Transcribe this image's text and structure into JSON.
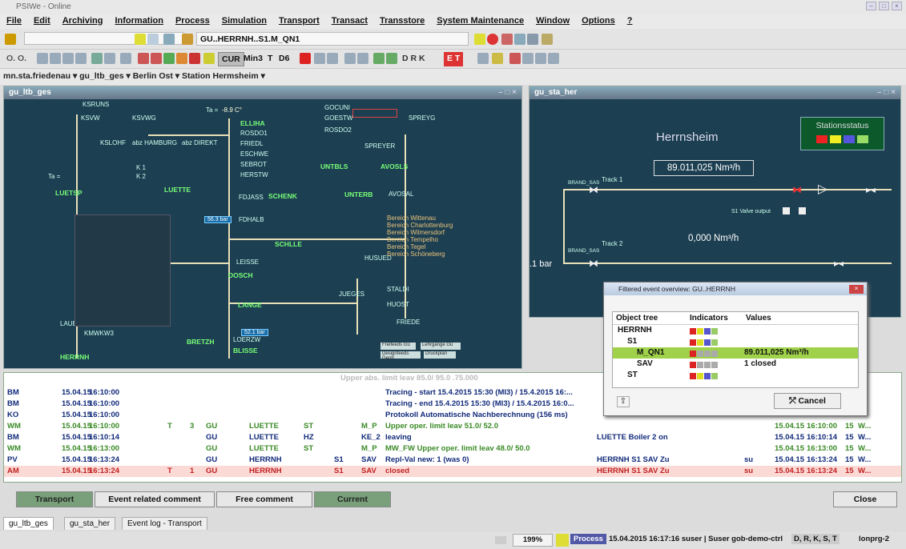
{
  "app": {
    "title": "PSIWe - Online"
  },
  "menu": [
    "File",
    "Edit",
    "Archiving",
    "Information",
    "Process",
    "Simulation",
    "Transport",
    "Transact",
    "Transstore",
    "System Maintenance",
    "Window",
    "Options",
    "?"
  ],
  "toolbar": {
    "object_path": "GU..HERRNH..S1.M_QN1",
    "left_group": "O. O.",
    "cur": "CUR",
    "min3": "Min3",
    "t": "T",
    "d6": "D6",
    "drk": "D R K",
    "gates": "E T"
  },
  "breadcrumbs": [
    "mn.sta.friedenau",
    "gu_ltb_ges",
    "Berlin Ost",
    "Station Hermsheim"
  ],
  "windows": {
    "main": {
      "title": "gu_ltb_ges"
    },
    "station": {
      "title": "gu_sta_her",
      "name": "Herrnsheim",
      "status_label": "Stationsstatus",
      "flow1": "89.011,025 Nm³/h",
      "flow2": "0,000 Nm³/h",
      "track1": "Track 1",
      "track2": "Track 2",
      "brand_sas": "BRAND_SAS",
      "valve_output": "S1 Valve output",
      "pressure": ".1 bar",
      "status_colors": [
        "#e22",
        "#ee2",
        "#55d",
        "#9d6"
      ]
    }
  },
  "schematic": {
    "nodes": [
      "KSRUNS",
      "KSVW",
      "KSVWG",
      "KSLOHF",
      "abz HAMBURG",
      "abz DIREKT",
      "ELLIHA",
      "ROSDO1",
      "FRIEDL",
      "ESCHWE",
      "SEBROT",
      "HERSTW",
      "GOCUNI",
      "GOESTW",
      "ROSDO2",
      "SPREYG",
      "SPREYER",
      "UNTBLS",
      "AVOSLS",
      "SCHENK",
      "UNTERB",
      "AVOSAL",
      "FDJASS",
      "FDHALB",
      "SCHLLE",
      "LEISSE",
      "DOSCH",
      "STALDI",
      "JUEGES",
      "HUOST",
      "FRIEDE",
      "LANGE",
      "LAUBEN",
      "KMWKW3",
      "BRETZH",
      "LOERZW",
      "BLISSE",
      "HERRNH",
      "LUETTE",
      "LUETSP",
      "HUSUED"
    ],
    "temp": "Ta =",
    "temp_val": "-8.9 C°",
    "k1": "K 1",
    "k2": "K 2",
    "legend": [
      "Bereich Wittenau",
      "Bereich Charlottenburg",
      "Bereich Wilmersdorf",
      "Bereich Tempelho",
      "Bereich Tegel",
      "Bereich Schöneberg"
    ],
    "buttons": [
      "Freifeeds Gü",
      "Lehrgänge Gü",
      "Designfeeds Genb",
      "Druckplan"
    ]
  },
  "popup": {
    "title": "Filtered event overview: GU..HERRNH",
    "cols": [
      "Object tree",
      "Indicators",
      "Values"
    ],
    "rows": [
      {
        "name": "HERRNH",
        "value": ""
      },
      {
        "name": "S1",
        "value": ""
      },
      {
        "name": "M_QN1",
        "value": "89.011,025 Nm³/h"
      },
      {
        "name": "SAV",
        "value": "1 closed"
      },
      {
        "name": "ST",
        "value": ""
      }
    ],
    "cancel": "Cancel"
  },
  "log": {
    "top_hidden": "Upper abs. limit leav 85.0/ 95.0 .75.000",
    "rows": [
      {
        "type": "BM",
        "date": "15.04.15",
        "time": "16:10:00",
        "a": "",
        "b": "",
        "c": "",
        "d": "",
        "e": "",
        "f": "",
        "g": "",
        "text": "Tracing - start 15.4.2015 15:30 (MI3) / 15.4.2015 16:...",
        "obj": "",
        "user": "",
        "d2": "",
        "t2": "",
        "n": "",
        "w": ""
      },
      {
        "type": "BM",
        "date": "15.04.15",
        "time": "16:10:00",
        "a": "",
        "b": "",
        "c": "",
        "d": "",
        "e": "",
        "f": "",
        "g": "",
        "text": "Tracing - end 15.4.2015 15:30 (MI3) / 15.4.2015 16:0...",
        "obj": "",
        "user": "",
        "d2": "",
        "t2": "",
        "n": "",
        "w": ""
      },
      {
        "type": "KO",
        "date": "15.04.15",
        "time": "16:10:00",
        "a": "",
        "b": "",
        "c": "",
        "d": "",
        "e": "",
        "f": "",
        "g": "",
        "text": "Protokoll Automatische Nachberechnung (156 ms)",
        "obj": "",
        "user": "",
        "d2": "",
        "t2": "",
        "n": "",
        "w": ""
      },
      {
        "type": "WM",
        "date": "15.04.15",
        "time": "16:10:00",
        "a": "T",
        "b": "3",
        "c": "GU",
        "d": "LUETTE",
        "e": "ST",
        "f": "",
        "g": "M_P",
        "text": "Upper oper. limit leav 51.0/ 52.0",
        "obj": "",
        "user": "",
        "d2": "15.04.15",
        "t2": "16:10:00",
        "n": "15",
        "w": "W..."
      },
      {
        "type": "BM",
        "date": "15.04.15",
        "time": "16:10:14",
        "a": "",
        "b": "",
        "c": "GU",
        "d": "LUETTE",
        "e": "HZ",
        "f": "",
        "g": "KE_2",
        "text": "leaving",
        "obj": "LUETTE Boiler 2 on",
        "user": "",
        "d2": "15.04.15",
        "t2": "16:10:14",
        "n": "15",
        "w": "W..."
      },
      {
        "type": "WM",
        "date": "15.04.15",
        "time": "16:13:00",
        "a": "",
        "b": "",
        "c": "GU",
        "d": "LUETTE",
        "e": "ST",
        "f": "",
        "g": "M_P",
        "text": "MW_FW Upper oper. limit leav 48.0/ 50.0",
        "obj": "",
        "user": "",
        "d2": "15.04.15",
        "t2": "16:13:00",
        "n": "15",
        "w": "W..."
      },
      {
        "type": "PV",
        "date": "15.04.15",
        "time": "16:13:24",
        "a": "",
        "b": "",
        "c": "GU",
        "d": "HERRNH",
        "e": "",
        "f": "S1",
        "g": "SAV",
        "text": "Repl-Val new: 1 (was 0)",
        "obj": "HERRNH S1 SAV Zu",
        "user": "su",
        "d2": "15.04.15",
        "t2": "16:13:24",
        "n": "15",
        "w": "W..."
      },
      {
        "type": "AM",
        "date": "15.04.15",
        "time": "16:13:24",
        "a": "T",
        "b": "1",
        "c": "GU",
        "d": "HERRNH",
        "e": "",
        "f": "S1",
        "g": "SAV",
        "text": "closed",
        "obj": "HERRNH S1 SAV Zu",
        "user": "su",
        "d2": "15.04.15",
        "t2": "16:13:24",
        "n": "15",
        "w": "W..."
      }
    ]
  },
  "bottom_buttons": {
    "transport": "Transport",
    "event_comment": "Event related comment",
    "free_comment": "Free comment",
    "current": "Current",
    "close": "Close"
  },
  "tabs": [
    "gu_ltb_ges",
    "gu_sta_her",
    "Event log - Transport"
  ],
  "status": {
    "zoom": "199%",
    "mode": "Process",
    "info": "15.04.2015 16:17:16 suser | Suser gob-demo-ctrl",
    "flags": "D, R, K, S, T",
    "host": "lonprg-2"
  }
}
